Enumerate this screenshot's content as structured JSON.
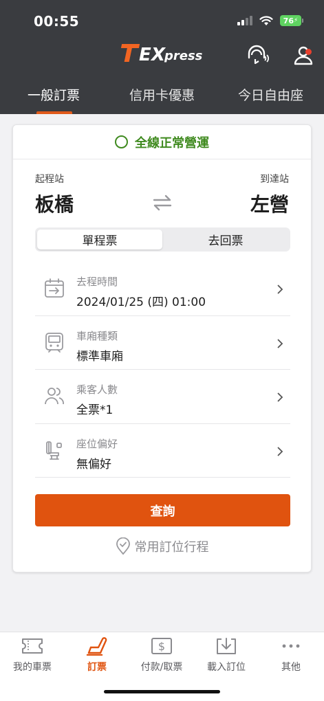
{
  "status_bar": {
    "time": "00:55",
    "battery": "76"
  },
  "header": {
    "logo_text": "TEXpress",
    "icons": [
      "help-headset-icon",
      "user-profile-icon"
    ],
    "tabs": [
      {
        "label": "一般訂票",
        "active": true
      },
      {
        "label": "信用卡優惠",
        "active": false
      },
      {
        "label": "今日自由座",
        "active": false
      }
    ]
  },
  "card": {
    "service_status": "全線正常營運",
    "from_label": "起程站",
    "from_station": "板橋",
    "to_label": "到達站",
    "to_station": "左營",
    "trip_types": [
      {
        "label": "單程票",
        "selected": true
      },
      {
        "label": "去回票",
        "selected": false
      }
    ],
    "rows": [
      {
        "label": "去程時間",
        "value": "2024/01/25 (四) 01:00",
        "icon": "calendar-icon"
      },
      {
        "label": "車廂種類",
        "value": "標準車廂",
        "icon": "train-car-icon"
      },
      {
        "label": "乘客人數",
        "value": "全票*1",
        "icon": "passengers-icon"
      },
      {
        "label": "座位偏好",
        "value": "無偏好",
        "icon": "seat-icon"
      }
    ],
    "search_button": "查詢",
    "favorite_label": "常用訂位行程"
  },
  "bottom_nav": [
    {
      "label": "我的車票",
      "icon": "ticket-icon",
      "active": false
    },
    {
      "label": "訂票",
      "icon": "seat-booking-icon",
      "active": true
    },
    {
      "label": "付款/取票",
      "icon": "payment-icon",
      "active": false
    },
    {
      "label": "載入訂位",
      "icon": "download-icon",
      "active": false
    },
    {
      "label": "其他",
      "icon": "more-icon",
      "active": false
    }
  ],
  "colors": {
    "header_bg": "#3a3c40",
    "accent": "#e0530f",
    "status_green": "#3f8a1f",
    "battery_green": "#5fd361",
    "logo_accent": "#f26522"
  }
}
